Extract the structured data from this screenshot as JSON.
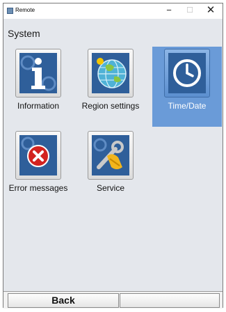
{
  "window": {
    "title": "Remote",
    "minimize_glyph": "−",
    "maximize_glyph": "☐",
    "close_glyph": "✕"
  },
  "section": {
    "title": "System"
  },
  "tiles": [
    {
      "label": "Information",
      "icon": "information-icon",
      "selected": false
    },
    {
      "label": "Region settings",
      "icon": "globe-icon",
      "selected": false
    },
    {
      "label": "Time/Date",
      "icon": "clock-icon",
      "selected": true
    },
    {
      "label": "Error messages",
      "icon": "error-icon",
      "selected": false
    },
    {
      "label": "Service",
      "icon": "service-tools-icon",
      "selected": false
    }
  ],
  "bottom_bar": {
    "back_label": "Back",
    "second_label": ""
  },
  "colors": {
    "selection": "#6a9bd8",
    "icon_blue": "#2f5f9a",
    "error_red": "#d3231f",
    "content_bg": "#e4e7ec"
  }
}
